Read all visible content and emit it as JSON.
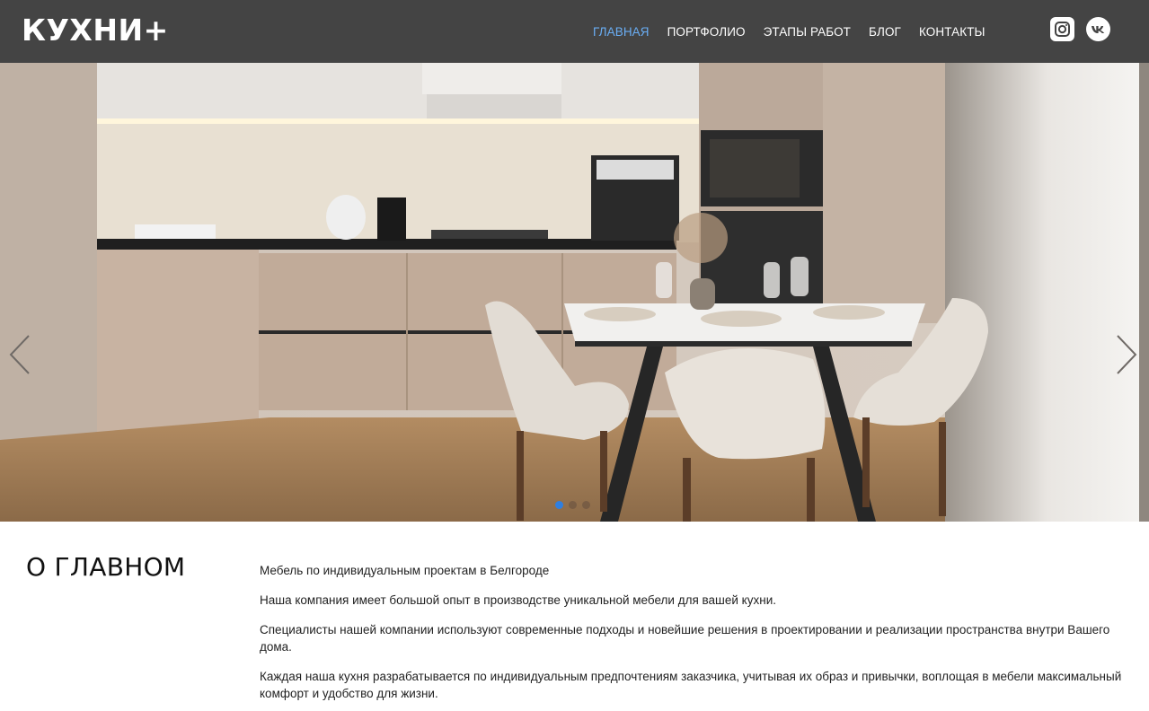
{
  "brand": {
    "logo": "КУХНИ+"
  },
  "nav": {
    "items": [
      {
        "label": "ГЛАВНАЯ",
        "active": true
      },
      {
        "label": "ПОРТФОЛИО",
        "active": false
      },
      {
        "label": "ЭТАПЫ РАБОТ",
        "active": false
      },
      {
        "label": "БЛОГ",
        "active": false
      },
      {
        "label": "КОНТАКТЫ",
        "active": false
      }
    ],
    "active_color": "#6aaef5"
  },
  "social": [
    {
      "icon": "instagram-icon"
    },
    {
      "icon": "vk-icon"
    }
  ],
  "slider": {
    "slide_count": 3,
    "active_index": 0,
    "prev_icon": "chevron-left-icon",
    "next_icon": "chevron-right-icon",
    "dot_active_color": "#2f7fe0"
  },
  "about": {
    "title": "О ГЛАВНОМ",
    "paragraphs": [
      "Мебель по индивидуальным проектам в Белгороде",
      "Наша компания имеет большой опыт в производстве уникальной мебели для вашей кухни.",
      "Специалисты нашей компании используют современные подходы и новейшие решения в проектировании и реализации пространства внутри Вашего дома.",
      "Каждая наша кухня разрабатывается по индивидуальным предпочтениям заказчика, учитывая их образ и привычки, воплощая в мебели максимальный комфорт и удобство для жизни."
    ]
  },
  "colors": {
    "header_bg": "#444444"
  }
}
